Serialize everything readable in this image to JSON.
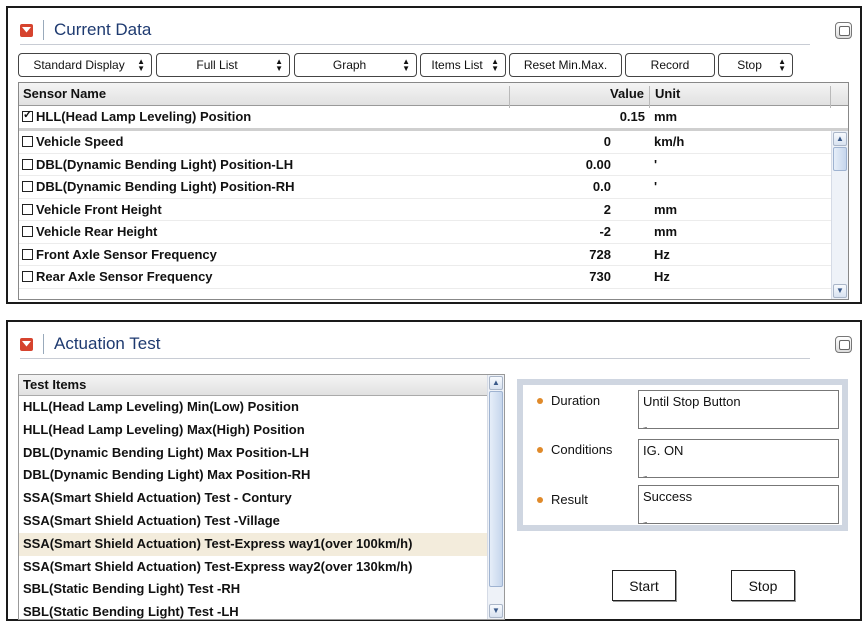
{
  "current": {
    "title": "Current Data",
    "toolbar": {
      "standard_display": "Standard Display",
      "full_list": "Full List",
      "graph": "Graph",
      "items_list": "Items List",
      "reset": "Reset Min.Max.",
      "record": "Record",
      "stop": "Stop"
    },
    "columns": {
      "name": "Sensor Name",
      "value": "Value",
      "unit": "Unit"
    },
    "fixed_row": {
      "name": "HLL(Head Lamp Leveling) Position",
      "value": "0.15",
      "unit": "mm",
      "checked": true
    },
    "rows": [
      {
        "name": "Vehicle Speed",
        "value": "0",
        "unit": "km/h"
      },
      {
        "name": "DBL(Dynamic Bending Light) Position-LH",
        "value": "0.00",
        "unit": "'"
      },
      {
        "name": "DBL(Dynamic Bending Light) Position-RH",
        "value": "0.0",
        "unit": "'"
      },
      {
        "name": "Vehicle Front Height",
        "value": "2",
        "unit": "mm"
      },
      {
        "name": "Vehicle Rear Height",
        "value": "-2",
        "unit": "mm"
      },
      {
        "name": "Front Axle Sensor Frequency",
        "value": "728",
        "unit": "Hz"
      },
      {
        "name": "Rear Axle Sensor Frequency",
        "value": "730",
        "unit": "Hz"
      }
    ]
  },
  "actuation": {
    "title": "Actuation Test",
    "list_header": "Test Items",
    "items": [
      "HLL(Head Lamp Leveling) Min(Low) Position",
      "HLL(Head Lamp Leveling) Max(High) Position",
      "DBL(Dynamic Bending Light) Max Position-LH",
      "DBL(Dynamic Bending Light) Max Position-RH",
      "SSA(Smart Shield Actuation) Test - Contury",
      "SSA(Smart Shield Actuation) Test -Village",
      "SSA(Smart Shield Actuation) Test-Express way1(over 100km/h)",
      "SSA(Smart Shield Actuation) Test-Express way2(over 130km/h)",
      "SBL(Static Bending Light) Test -RH",
      "SBL(Static Bending Light) Test -LH"
    ],
    "selected_index": 6,
    "info": {
      "duration_label": "Duration",
      "duration_value": "Until Stop Button",
      "conditions_label": "Conditions",
      "conditions_value": "IG. ON",
      "result_label": "Result",
      "result_value": "Success"
    },
    "start_label": "Start",
    "stop_label": "Stop"
  },
  "colors": {
    "accent_icon": "#d6432e",
    "title_text": "#1e3a70",
    "bullet": "#e08a2a",
    "selected_row": "#f3ecdc"
  }
}
